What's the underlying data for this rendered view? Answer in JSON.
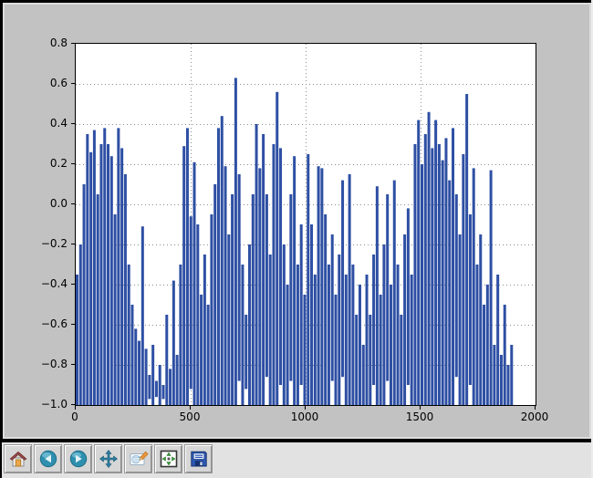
{
  "window": {
    "frame_color": "#000000",
    "canvas_bg": "#c2c2c2",
    "bevel_color": "#dcdcdc",
    "toolbar_bg": "#e2e2e2",
    "button_bg": "#d6d6d6"
  },
  "toolbar": {
    "buttons": [
      {
        "id": "home",
        "icon": "home-icon"
      },
      {
        "id": "back",
        "icon": "back-icon"
      },
      {
        "id": "forward",
        "icon": "forward-icon"
      },
      {
        "id": "pan",
        "icon": "pan-icon"
      },
      {
        "id": "zoom",
        "icon": "zoom-rect-icon"
      },
      {
        "id": "subplots",
        "icon": "configure-subplots-icon"
      },
      {
        "id": "save",
        "icon": "save-icon"
      }
    ]
  },
  "chart_data": {
    "type": "line",
    "title": "",
    "xlabel": "",
    "ylabel": "",
    "xlim": [
      0,
      2000
    ],
    "ylim": [
      -1.0,
      0.8
    ],
    "grid": true,
    "grid_style": "dotted",
    "grid_color": "#8c8c8c",
    "line_color": "#2e4fa3",
    "xticks": [
      {
        "v": 0,
        "label": "0"
      },
      {
        "v": 500,
        "label": "500"
      },
      {
        "v": 1000,
        "label": "1000"
      },
      {
        "v": 1500,
        "label": "1500"
      },
      {
        "v": 2000,
        "label": "2000"
      }
    ],
    "yticks": [
      {
        "v": 0.8,
        "label": "0.8"
      },
      {
        "v": 0.6,
        "label": "0.6"
      },
      {
        "v": 0.4,
        "label": "0.4"
      },
      {
        "v": 0.2,
        "label": "0.2"
      },
      {
        "v": 0.0,
        "label": "0.0"
      },
      {
        "v": -0.2,
        "label": "−0.2"
      },
      {
        "v": -0.4,
        "label": "−0.4"
      },
      {
        "v": -0.6,
        "label": "−0.6"
      },
      {
        "v": -0.8,
        "label": "−0.8"
      },
      {
        "v": -1.0,
        "label": "−1.0"
      }
    ],
    "envelope": {
      "x_start": 0,
      "x_step": 15,
      "tops": [
        -0.35,
        -0.2,
        0.1,
        0.35,
        0.26,
        0.37,
        0.05,
        0.3,
        0.38,
        0.3,
        0.24,
        -0.05,
        0.38,
        0.28,
        0.15,
        -0.3,
        -0.5,
        -0.62,
        -0.68,
        -0.11,
        -0.72,
        -0.85,
        -0.7,
        -0.88,
        -0.8,
        -0.9,
        -0.55,
        -0.82,
        -0.38,
        -0.75,
        -0.3,
        0.29,
        0.38,
        -0.06,
        0.21,
        -0.1,
        -0.45,
        -0.25,
        -0.5,
        -0.05,
        0.1,
        0.38,
        0.44,
        0.19,
        -0.15,
        0.05,
        0.63,
        0.15,
        -0.3,
        -0.55,
        -0.2,
        0.05,
        0.4,
        0.18,
        0.35,
        0.05,
        -0.25,
        0.3,
        0.56,
        0.28,
        -0.2,
        -0.4,
        0.05,
        0.24,
        -0.3,
        -0.1,
        -0.45,
        0.25,
        -0.1,
        -0.35,
        0.19,
        0.18,
        -0.05,
        -0.3,
        -0.15,
        -0.45,
        -0.25,
        0.12,
        -0.35,
        0.15,
        -0.3,
        -0.55,
        -0.4,
        -0.7,
        -0.35,
        -0.55,
        -0.25,
        0.09,
        -0.45,
        -0.2,
        0.05,
        -0.4,
        0.12,
        -0.3,
        -0.55,
        -0.15,
        -0.02,
        -0.35,
        0.3,
        0.42,
        0.2,
        0.35,
        0.46,
        0.28,
        0.42,
        0.3,
        0.22,
        0.33,
        0.12,
        0.38,
        0.05,
        -0.15,
        0.25,
        0.55,
        -0.05,
        0.18,
        -0.3,
        -0.15,
        -0.5,
        -0.4,
        0.17,
        -0.7,
        -0.35,
        -0.75,
        -0.5,
        -0.8,
        -0.7
      ],
      "bottom_default": -1.0,
      "bottom_exceptions": {
        "21": -0.97,
        "23": -0.96,
        "25": -0.97,
        "33": -0.92,
        "47": -0.88,
        "49": -0.92,
        "55": -0.86,
        "59": -0.9,
        "62": -0.88,
        "65": -0.9,
        "74": -0.88,
        "77": -0.86,
        "86": -0.9,
        "90": -0.88,
        "96": -0.9,
        "110": -0.86,
        "114": -0.9
      }
    }
  }
}
